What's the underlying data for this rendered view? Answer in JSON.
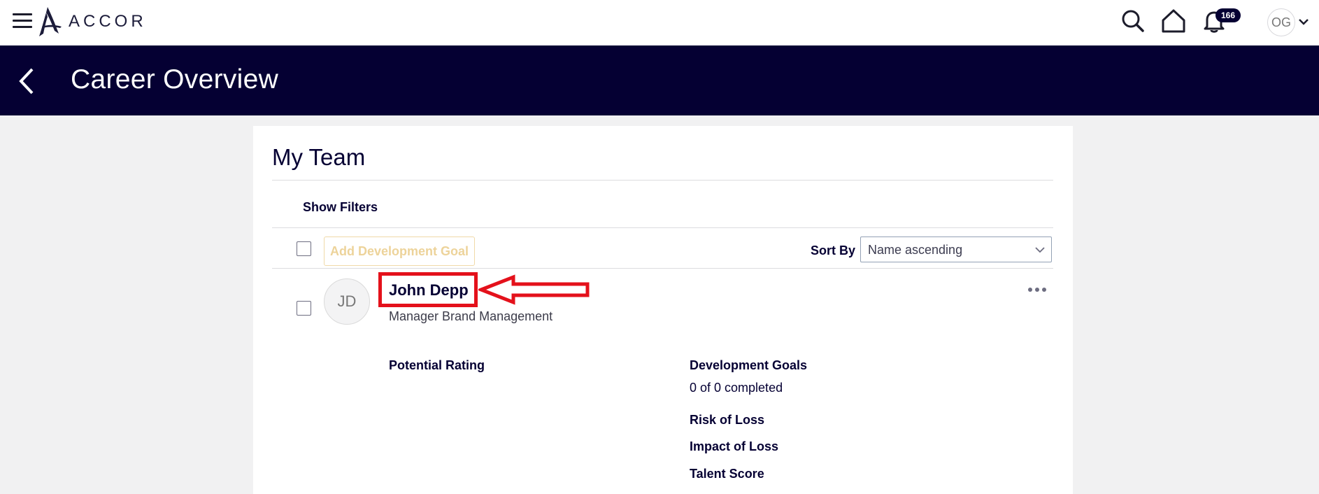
{
  "app": {
    "brand": "ACCOR",
    "notifications_count": "166",
    "user_initials": "OG"
  },
  "header": {
    "title": "Career Overview"
  },
  "team": {
    "title": "My Team",
    "show_filters_label": "Show Filters",
    "add_goal_label": "Add Development Goal",
    "sort_by_label": "Sort By",
    "sort_value": "Name ascending"
  },
  "member": {
    "initials": "JD",
    "name": "John Depp",
    "role": "Manager Brand Management",
    "potential_rating_label": "Potential Rating",
    "development_goals_label": "Development Goals",
    "development_goals_value": "0 of 0 completed",
    "risk_of_loss_label": "Risk of Loss",
    "impact_of_loss_label": "Impact of Loss",
    "talent_score_label": "Talent Score"
  },
  "annotation": {
    "highlight_color": "#e4111b"
  },
  "icons": {
    "menu": "hamburger-menu-icon",
    "search": "search-icon",
    "home": "home-icon",
    "notifications": "bell-icon",
    "back": "back-arrow-icon",
    "more": "more-options-icon",
    "chevron": "chevron-down-icon"
  },
  "colors": {
    "header_bg": "#050033",
    "accent_disabled": "#edd39a",
    "page_bg": "#f1f1f2"
  }
}
